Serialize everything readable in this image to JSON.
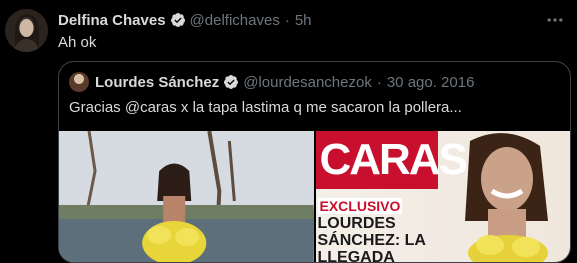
{
  "tweet": {
    "author_name": "Delfina Chaves",
    "handle": "@delfichaves",
    "separator": "·",
    "time": "5h",
    "text": "Ah ok",
    "more_icon": "more-horizontal-icon"
  },
  "quoted": {
    "author_name": "Lourdes Sánchez",
    "handle": "@lourdesanchezok",
    "separator": "·",
    "date": "30 ago. 2016",
    "text": "Gracias @caras x la tapa lastima q me sacaron la pollera...",
    "magazine_brand": "CARAS",
    "badge": "EXCLUSIVO",
    "headline": "LOURDES SÁNCHEZ: LA LLEGADA"
  },
  "colors": {
    "background": "#000000",
    "text": "#d9d9d9",
    "muted": "#6e767d",
    "verified": "#d9d9d9",
    "border": "#3d4249",
    "brand_red": "#c8102e"
  }
}
